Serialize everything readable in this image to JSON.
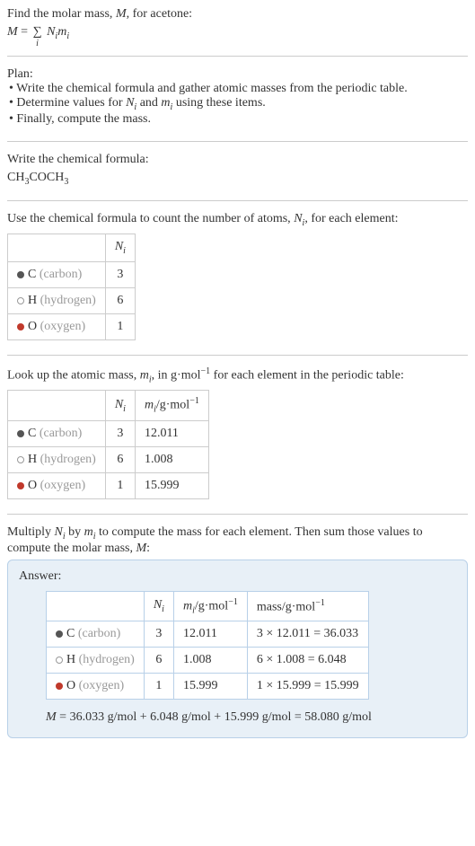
{
  "intro": {
    "line1": "Find the molar mass, ",
    "var_M": "M",
    "line1b": ", for acetone:",
    "eq_M": "M",
    "eq_equals": " = ",
    "eq_sigma": "∑",
    "eq_sigma_sub": "i",
    "eq_Ni": "N",
    "eq_i1": "i",
    "eq_mi": "m",
    "eq_i2": "i"
  },
  "plan": {
    "title": "Plan:",
    "item1a": "• Write the chemical formula and gather atomic masses from the periodic table.",
    "item2a": "• Determine values for ",
    "item2_Ni": "N",
    "item2_i1": "i",
    "item2b": " and ",
    "item2_mi": "m",
    "item2_i2": "i",
    "item2c": " using these items.",
    "item3": "• Finally, compute the mass."
  },
  "chem": {
    "title": "Write the chemical formula:",
    "f1": "CH",
    "s1": "3",
    "f2": "COCH",
    "s2": "3"
  },
  "atoms": {
    "title1": "Use the chemical formula to count the number of atoms, ",
    "Ni": "N",
    "i": "i",
    "title2": ", for each element:",
    "hdr_Ni": "N",
    "hdr_i": "i",
    "rows": [
      {
        "sym": "C",
        "name": " (carbon)",
        "dot": "dot-c",
        "n": "3"
      },
      {
        "sym": "H",
        "name": " (hydrogen)",
        "dot": "dot-h",
        "n": "6"
      },
      {
        "sym": "O",
        "name": " (oxygen)",
        "dot": "dot-o",
        "n": "1"
      }
    ]
  },
  "masses": {
    "title1": "Look up the atomic mass, ",
    "mi": "m",
    "i": "i",
    "title2": ", in g·mol",
    "exp": "−1",
    "title3": " for each element in the periodic table:",
    "hdr_Ni": "N",
    "hdr_Ni_i": "i",
    "hdr_mi": "m",
    "hdr_mi_i": "i",
    "hdr_unit": "/g·mol",
    "hdr_exp": "−1",
    "rows": [
      {
        "sym": "C",
        "name": " (carbon)",
        "dot": "dot-c",
        "n": "3",
        "m": "12.011"
      },
      {
        "sym": "H",
        "name": " (hydrogen)",
        "dot": "dot-h",
        "n": "6",
        "m": "1.008"
      },
      {
        "sym": "O",
        "name": " (oxygen)",
        "dot": "dot-o",
        "n": "1",
        "m": "15.999"
      }
    ]
  },
  "compute": {
    "title1": "Multiply ",
    "Ni": "N",
    "i1": "i",
    "title2": " by ",
    "mi": "m",
    "i2": "i",
    "title3": " to compute the mass for each element. Then sum those values to compute the molar mass, ",
    "M": "M",
    "title4": ":"
  },
  "answer": {
    "label": "Answer:",
    "hdr_Ni": "N",
    "hdr_Ni_i": "i",
    "hdr_mi": "m",
    "hdr_mi_i": "i",
    "hdr_mi_unit": "/g·mol",
    "hdr_mi_exp": "−1",
    "hdr_mass": "mass/g·mol",
    "hdr_mass_exp": "−1",
    "rows": [
      {
        "sym": "C",
        "name": " (carbon)",
        "dot": "dot-c",
        "n": "3",
        "m": "12.011",
        "calc": "3 × 12.011 = 36.033"
      },
      {
        "sym": "H",
        "name": " (hydrogen)",
        "dot": "dot-h",
        "n": "6",
        "m": "1.008",
        "calc": "6 × 1.008 = 6.048"
      },
      {
        "sym": "O",
        "name": " (oxygen)",
        "dot": "dot-o",
        "n": "1",
        "m": "15.999",
        "calc": "1 × 15.999 = 15.999"
      }
    ],
    "final_M": "M",
    "final_eq": " = 36.033 g/mol + 6.048 g/mol + 15.999 g/mol = 58.080 g/mol"
  }
}
